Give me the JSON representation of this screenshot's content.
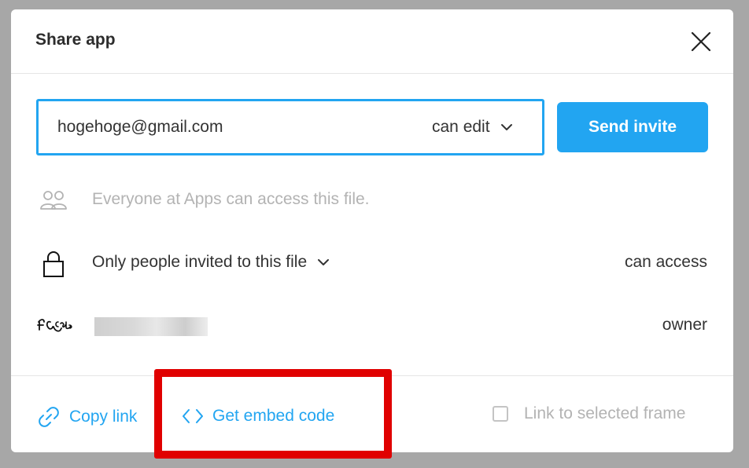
{
  "dialog": {
    "title": "Share app",
    "close_icon": "close-icon"
  },
  "invite": {
    "email_value": "hogehoge@gmail.com",
    "permission": "can edit",
    "send_label": "Send invite",
    "accent_color": "#22a5f1"
  },
  "access_rows": [
    {
      "icon": "team-icon",
      "text": "Everyone at Apps can access this file.",
      "right": ""
    },
    {
      "icon": "lock-icon",
      "text": "Only people invited to this file",
      "right": "can access"
    },
    {
      "icon": "avatar-logo",
      "text": "",
      "right": "owner"
    }
  ],
  "footer": {
    "copy_link": "Copy link",
    "embed_code": "Get embed code",
    "link_to_frame": "Link to selected frame",
    "link_to_frame_checked": false
  },
  "annotation": {
    "highlight_color": "#e00000"
  }
}
